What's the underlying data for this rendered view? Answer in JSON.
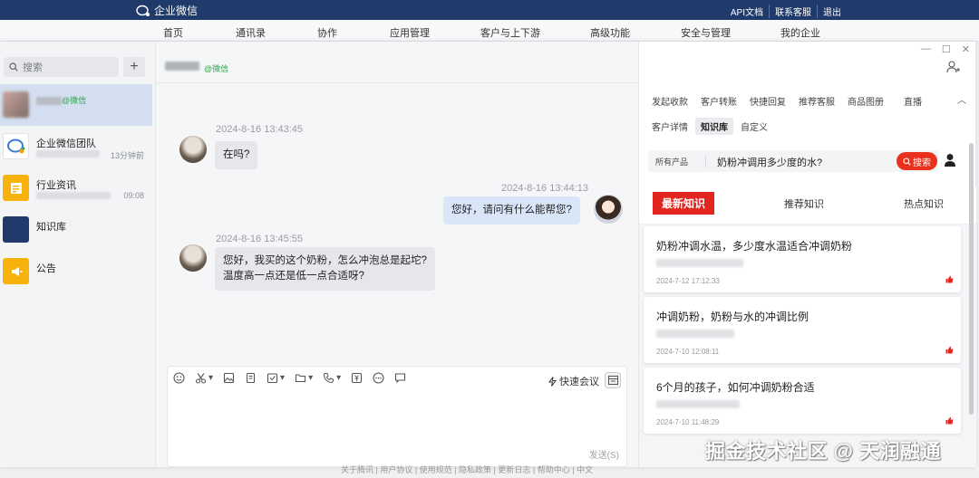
{
  "topbar": {
    "brand": "企业微信",
    "links": [
      "API文档",
      "联系客服",
      "退出"
    ]
  },
  "nav": {
    "items": [
      "首页",
      "通讯录",
      "协作",
      "应用管理",
      "客户与上下游",
      "高级功能",
      "安全与管理",
      "我的企业"
    ]
  },
  "sidebar": {
    "search_placeholder": "搜索",
    "add_icon": "plus-icon",
    "conversations": [
      {
        "name": "@微信",
        "time": "",
        "icon": "blurred-avatar"
      },
      {
        "name": "企业微信团队",
        "time": "13分钟前",
        "icon": "wecom-logo-icon",
        "color": "#ffffff"
      },
      {
        "name": "行业资讯",
        "time": "09:08",
        "icon": "news-icon",
        "color": "#f7b30b"
      },
      {
        "name": "知识库",
        "time": "",
        "icon": "knowledge-icon",
        "color": "#1f3a6b"
      },
      {
        "name": "公告",
        "time": "",
        "icon": "megaphone-icon",
        "color": "#f7b30b"
      }
    ]
  },
  "chat": {
    "header_suffix": "@微信",
    "messages": [
      {
        "time": "2024-8-16 13:43:45",
        "text": "在吗?",
        "dir": "in"
      },
      {
        "time": "2024-8-16 13:44:13",
        "text": "您好，请问有什么能帮您?",
        "dir": "out"
      },
      {
        "time": "2024-8-16 13:45:55",
        "text": "您好，我买的这个奶粉，怎么冲泡总是起坨?",
        "text2": "温度高一点还是低一点合适呀?",
        "dir": "in"
      }
    ],
    "composer": {
      "quick_meeting": "快速会议",
      "send": "发送(S)"
    }
  },
  "panel": {
    "tabs_row1": [
      "发起收款",
      "客户转账",
      "快捷回复",
      "推荐客服",
      "商品图册",
      "直播"
    ],
    "tabs_row2": [
      "客户详情",
      "知识库",
      "自定义"
    ],
    "selected_tab": "知识库",
    "search": {
      "product": "所有产品",
      "query": "奶粉冲调用多少度的水?",
      "button": "搜索"
    },
    "categories": [
      "最新知识",
      "推荐知识",
      "热点知识"
    ],
    "cards": [
      {
        "title": "奶粉冲调水温，多少度水温适合冲调奶粉",
        "date": "2024-7-12 17:12:33"
      },
      {
        "title": "冲调奶粉，奶粉与水的冲调比例",
        "date": "2024-7-10 12:08:11"
      },
      {
        "title": "6个月的孩子，如何冲调奶粉合适",
        "date": "2024-7-10 11:48:29"
      }
    ]
  },
  "footer": {
    "text": "关于腾讯 | 用户协议 | 使用规范 | 隐私政策 | 更新日志 | 帮助中心 | 中文"
  },
  "watermark": "掘金技术社区 @ 天润融通",
  "colors": {
    "brand": "#1f3a6b",
    "accent_red": "#e2261f",
    "wechat_green": "#2fa54b"
  }
}
